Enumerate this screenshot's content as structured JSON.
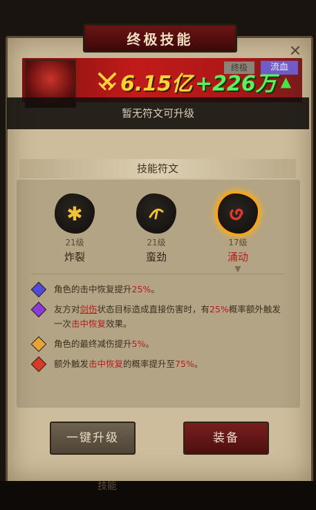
{
  "title": "终极技能",
  "hero": {
    "tag_gray": "终极",
    "tag_purple": "流血",
    "power_value": "6.15亿",
    "power_gain": "+226万"
  },
  "notice": "暂无符文可升级",
  "section_title": "技能符文",
  "runes": [
    {
      "level": "21级",
      "name": "炸裂",
      "active": false,
      "glyph": "✱",
      "glyph_color": "#f0c23a"
    },
    {
      "level": "21级",
      "name": "蛮劲",
      "active": false,
      "glyph": "⌒",
      "glyph_color": "#f0c23a"
    },
    {
      "level": "17级",
      "name": "涌动",
      "active": true,
      "glyph": "◉",
      "glyph_color": "#e23a2a"
    }
  ],
  "effects": [
    {
      "gem_color": "#4f4ad8",
      "prefix": "角色的击中恢复提升",
      "highlight": "25%",
      "suffix": "。"
    },
    {
      "gem_color": "#8a3ad8",
      "prefix": "友方对",
      "link": "剑伤",
      "mid": "状态目标造成直接伤害时，有",
      "highlight": "25%",
      "mid2": "概率额外触发一次",
      "highlight2": "击中恢复",
      "suffix": "效果。"
    },
    {
      "gem_color": "#e8a23a",
      "prefix": "角色的最终减伤提升",
      "highlight": "5%",
      "suffix": "。"
    },
    {
      "gem_color": "#d83a2a",
      "prefix": "额外触发",
      "highlight": "击中恢复",
      "mid": "的概率提升至",
      "highlight2": "75%",
      "suffix": "。"
    }
  ],
  "buttons": {
    "upgrade": "一键升级",
    "equip": "装备"
  },
  "bottom_tab": "技能",
  "colors": {
    "accent_red": "#b81a1a",
    "power_yellow": "#ffd23a",
    "gain_green": "#5cf05c"
  }
}
